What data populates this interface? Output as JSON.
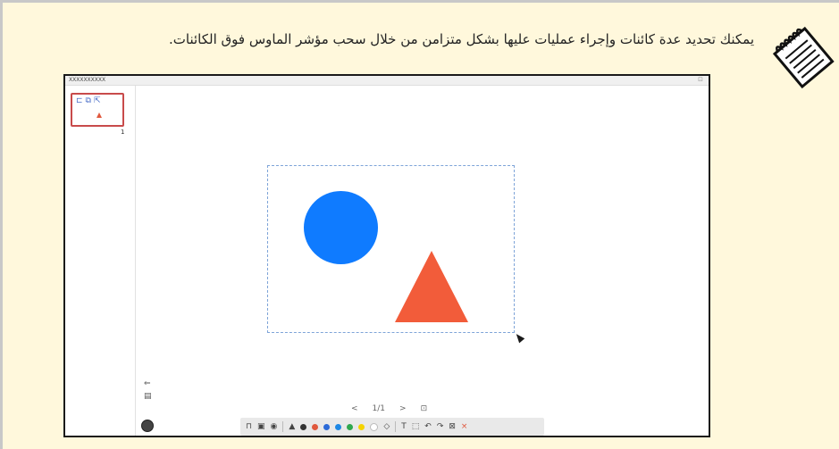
{
  "note": {
    "text": "يمكنك تحديد عدة كائنات وإجراء عمليات عليها بشكل متزامن من خلال سحب مؤشر الماوس فوق الكائنات.",
    "icon": "note-icon"
  },
  "screenshot": {
    "window_title": "XXXXXXXXXX",
    "thumbnail": {
      "page_number": "1",
      "icons": [
        "add-page-icon",
        "copy-page-icon",
        "delete-page-icon"
      ]
    },
    "side_buttons": [
      "import-icon",
      "whiteboard-icon",
      "record-icon"
    ],
    "shapes": [
      {
        "type": "circle",
        "color": "#0f7bff"
      },
      {
        "type": "triangle",
        "color": "#f25c3a"
      }
    ],
    "selection_color": "#7ea4d8",
    "pager": {
      "prev": "<",
      "page": "1/1",
      "next": ">",
      "add": "⊡"
    },
    "toolbar": {
      "items": [
        "window-icon",
        "save-icon",
        "camera-icon",
        "pen-icon",
        "marker-icon",
        "eraser-icon",
        "text-icon",
        "select-icon",
        "undo-icon",
        "redo-icon",
        "trash-icon",
        "close-icon"
      ],
      "colors": [
        "#333333",
        "#e0583d",
        "#2b6ad8",
        "#1e88e5",
        "#2fa84f",
        "#f5d300",
        "#ffffff"
      ]
    }
  }
}
